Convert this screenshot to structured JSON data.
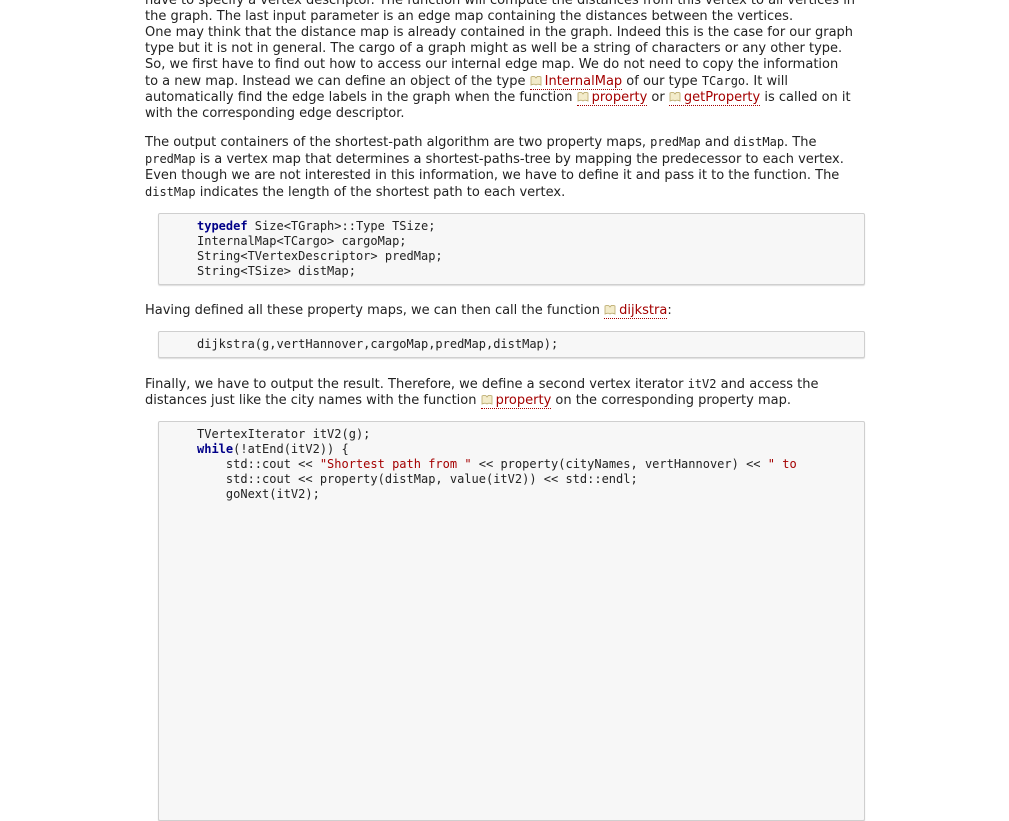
{
  "p1": {
    "l0": "have to specify a vertex descriptor. The function will compute the distances from this vertex to all vertices in",
    "l1": "the graph. The last input parameter is an edge map containing the distances between the vertices.",
    "l2": "One may think that the distance map is already contained in the graph. Indeed this is the case for our graph",
    "l3": "type but it is not in general. The cargo of a graph might as well be a string of characters or any other type.",
    "l4": "So, we first have to find out how to access our internal edge map. We do not need to copy the information",
    "l5a": "to a new map. Instead we can define an object of the type ",
    "l5_link": "InternalMap",
    "l5b": " of our type ",
    "l5_code": "TCargo",
    "l5c": ". It will",
    "l6a": "automatically find the edge labels in the graph when the function ",
    "l6_link1": "property",
    "l6b": " or ",
    "l6_link2": "getProperty",
    "l6c": " is called on it",
    "l7": "with the corresponding edge descriptor."
  },
  "p2": {
    "a": "The output containers of the shortest-path algorithm are two property maps, ",
    "c1": "predMap",
    "b": " and ",
    "c2": "distMap",
    "c": ". The",
    "c3": "predMap",
    "d": " is a vertex map that determines a shortest-paths-tree by mapping the predecessor to each vertex. Even though we are not interested in this information, we have to define it and pass it to the function. The ",
    "c4": "distMap",
    "e": " indicates the length of the shortest path to each vertex."
  },
  "code1": {
    "kw": "typedef",
    "l1_rest": " Size<TGraph>::Type TSize;",
    "l2": "InternalMap<TCargo> cargoMap;",
    "l3": "String<TVertexDescriptor> predMap;",
    "l4": "String<TSize> distMap;"
  },
  "p3": {
    "a": "Having defined all these property maps, we can then call the function ",
    "link": "dijkstra",
    "b": ":"
  },
  "code2": {
    "l1": "dijkstra(g,vertHannover,cargoMap,predMap,distMap);"
  },
  "p4": {
    "a": "Finally, we have to output the result. Therefore, we define a second vertex iterator ",
    "c1": "itV2",
    "b": " and access the",
    "c": "distances just like the city names with the function ",
    "link": "property",
    "d": " on the corresponding property map."
  },
  "code3": {
    "l1": "TVertexIterator itV2(g);",
    "kw": "while",
    "l2_rest": "(!atEnd(itV2)) {",
    "l3a": "    std::cout << ",
    "l3s": "\"Shortest path from \"",
    "l3b": " << property(cityNames, vertHannover) << ",
    "l3s2": "\" to",
    "l4": "    std::cout << property(distMap, value(itV2)) << std::endl;",
    "l5": "    goNext(itV2);"
  }
}
